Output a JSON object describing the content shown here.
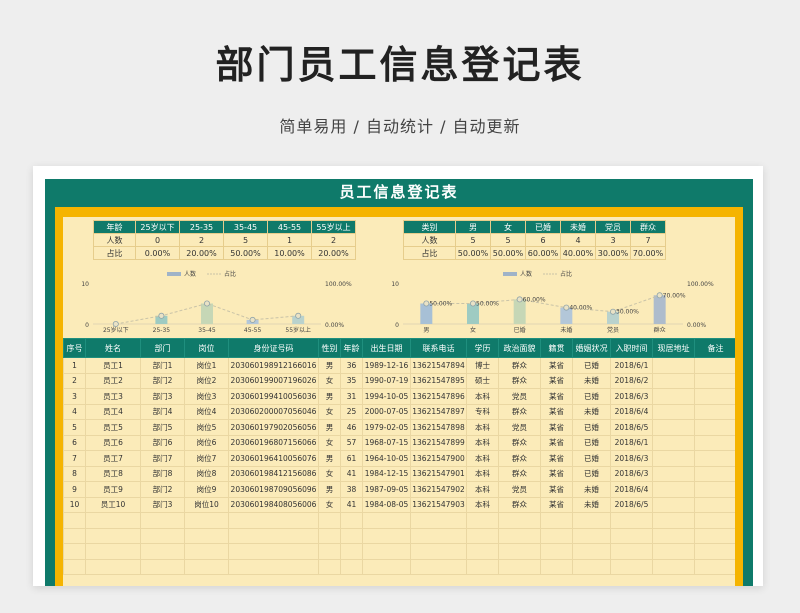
{
  "hero": {
    "title": "部门员工信息登记表",
    "subtitle": "简单易用 / 自动统计 / 自动更新"
  },
  "sheet": {
    "banner": "员工信息登记表"
  },
  "age_table": {
    "headers": [
      "年龄",
      "25岁以下",
      "25-35",
      "35-45",
      "45-55",
      "55岁以上"
    ],
    "rows": [
      [
        "人数",
        "0",
        "2",
        "5",
        "1",
        "2"
      ],
      [
        "占比",
        "0.00%",
        "20.00%",
        "50.00%",
        "10.00%",
        "20.00%"
      ]
    ]
  },
  "category_table": {
    "headers": [
      "类别",
      "男",
      "女",
      "已婚",
      "未婚",
      "党员",
      "群众"
    ],
    "rows": [
      [
        "人数",
        "5",
        "5",
        "6",
        "4",
        "3",
        "7"
      ],
      [
        "占比",
        "50.00%",
        "50.00%",
        "60.00%",
        "40.00%",
        "30.00%",
        "70.00%"
      ]
    ]
  },
  "chart_data": [
    {
      "type": "bar",
      "categories": [
        "25岁以下",
        "25-35",
        "35-45",
        "45-55",
        "55岁以上"
      ],
      "series": [
        {
          "name": "人数",
          "values": [
            0,
            2,
            5,
            1,
            2
          ]
        },
        {
          "name": "占比",
          "values": [
            0.0,
            20.0,
            50.0,
            10.0,
            20.0
          ]
        }
      ],
      "y_left_ticks": [
        "0",
        "10"
      ],
      "y_right_ticks": [
        "0.00%",
        "100.00%"
      ],
      "ylim": [
        0,
        10
      ],
      "y2lim": [
        0,
        100
      ],
      "legend": "top"
    },
    {
      "type": "bar",
      "categories": [
        "男",
        "女",
        "已婚",
        "未婚",
        "党员",
        "群众"
      ],
      "series": [
        {
          "name": "人数",
          "values": [
            5,
            5,
            6,
            4,
            3,
            7
          ]
        },
        {
          "name": "占比",
          "values": [
            50.0,
            50.0,
            60.0,
            40.0,
            30.0,
            70.0
          ]
        }
      ],
      "data_labels": [
        "50.00%",
        "50.00%",
        "60.00%",
        "40.00%",
        "30.00%",
        "70.00%"
      ],
      "y_left_ticks": [
        "0",
        "10"
      ],
      "y_right_ticks": [
        "0.00%",
        "100.00%"
      ],
      "ylim": [
        0,
        10
      ],
      "y2lim": [
        0,
        100
      ],
      "legend": "top"
    }
  ],
  "employees": {
    "columns": [
      "序号",
      "姓名",
      "部门",
      "岗位",
      "身份证号码",
      "性别",
      "年龄",
      "出生日期",
      "联系电话",
      "学历",
      "政治面貌",
      "籍贯",
      "婚姻状况",
      "入职时间",
      "现居地址",
      "备注"
    ],
    "rows": [
      [
        "1",
        "员工1",
        "部门1",
        "岗位1",
        "203060198912166016",
        "男",
        "36",
        "1989-12-16",
        "13621547894",
        "博士",
        "群众",
        "某省",
        "已婚",
        "2018/6/1",
        "",
        ""
      ],
      [
        "2",
        "员工2",
        "部门2",
        "岗位2",
        "203060199007196026",
        "女",
        "35",
        "1990-07-19",
        "13621547895",
        "硕士",
        "群众",
        "某省",
        "未婚",
        "2018/6/2",
        "",
        ""
      ],
      [
        "3",
        "员工3",
        "部门3",
        "岗位3",
        "203060199410056036",
        "男",
        "31",
        "1994-10-05",
        "13621547896",
        "本科",
        "党员",
        "某省",
        "已婚",
        "2018/6/3",
        "",
        ""
      ],
      [
        "4",
        "员工4",
        "部门4",
        "岗位4",
        "203060200007056046",
        "女",
        "25",
        "2000-07-05",
        "13621547897",
        "专科",
        "群众",
        "某省",
        "未婚",
        "2018/6/4",
        "",
        ""
      ],
      [
        "5",
        "员工5",
        "部门5",
        "岗位5",
        "203060197902056056",
        "男",
        "46",
        "1979-02-05",
        "13621547898",
        "本科",
        "党员",
        "某省",
        "已婚",
        "2018/6/5",
        "",
        ""
      ],
      [
        "6",
        "员工6",
        "部门6",
        "岗位6",
        "203060196807156066",
        "女",
        "57",
        "1968-07-15",
        "13621547899",
        "本科",
        "群众",
        "某省",
        "已婚",
        "2018/6/1",
        "",
        ""
      ],
      [
        "7",
        "员工7",
        "部门7",
        "岗位7",
        "203060196410056076",
        "男",
        "61",
        "1964-10-05",
        "13621547900",
        "本科",
        "群众",
        "某省",
        "已婚",
        "2018/6/3",
        "",
        ""
      ],
      [
        "8",
        "员工8",
        "部门8",
        "岗位8",
        "203060198412156086",
        "女",
        "41",
        "1984-12-15",
        "13621547901",
        "本科",
        "群众",
        "某省",
        "已婚",
        "2018/6/3",
        "",
        ""
      ],
      [
        "9",
        "员工9",
        "部门2",
        "岗位9",
        "203060198709056096",
        "男",
        "38",
        "1987-09-05",
        "13621547902",
        "本科",
        "党员",
        "某省",
        "未婚",
        "2018/6/4",
        "",
        ""
      ],
      [
        "10",
        "员工10",
        "部门3",
        "岗位10",
        "203060198408056006",
        "女",
        "41",
        "1984-08-05",
        "13621547903",
        "本科",
        "群众",
        "某省",
        "未婚",
        "2018/6/5",
        "",
        ""
      ]
    ],
    "empty_rows": 4
  }
}
